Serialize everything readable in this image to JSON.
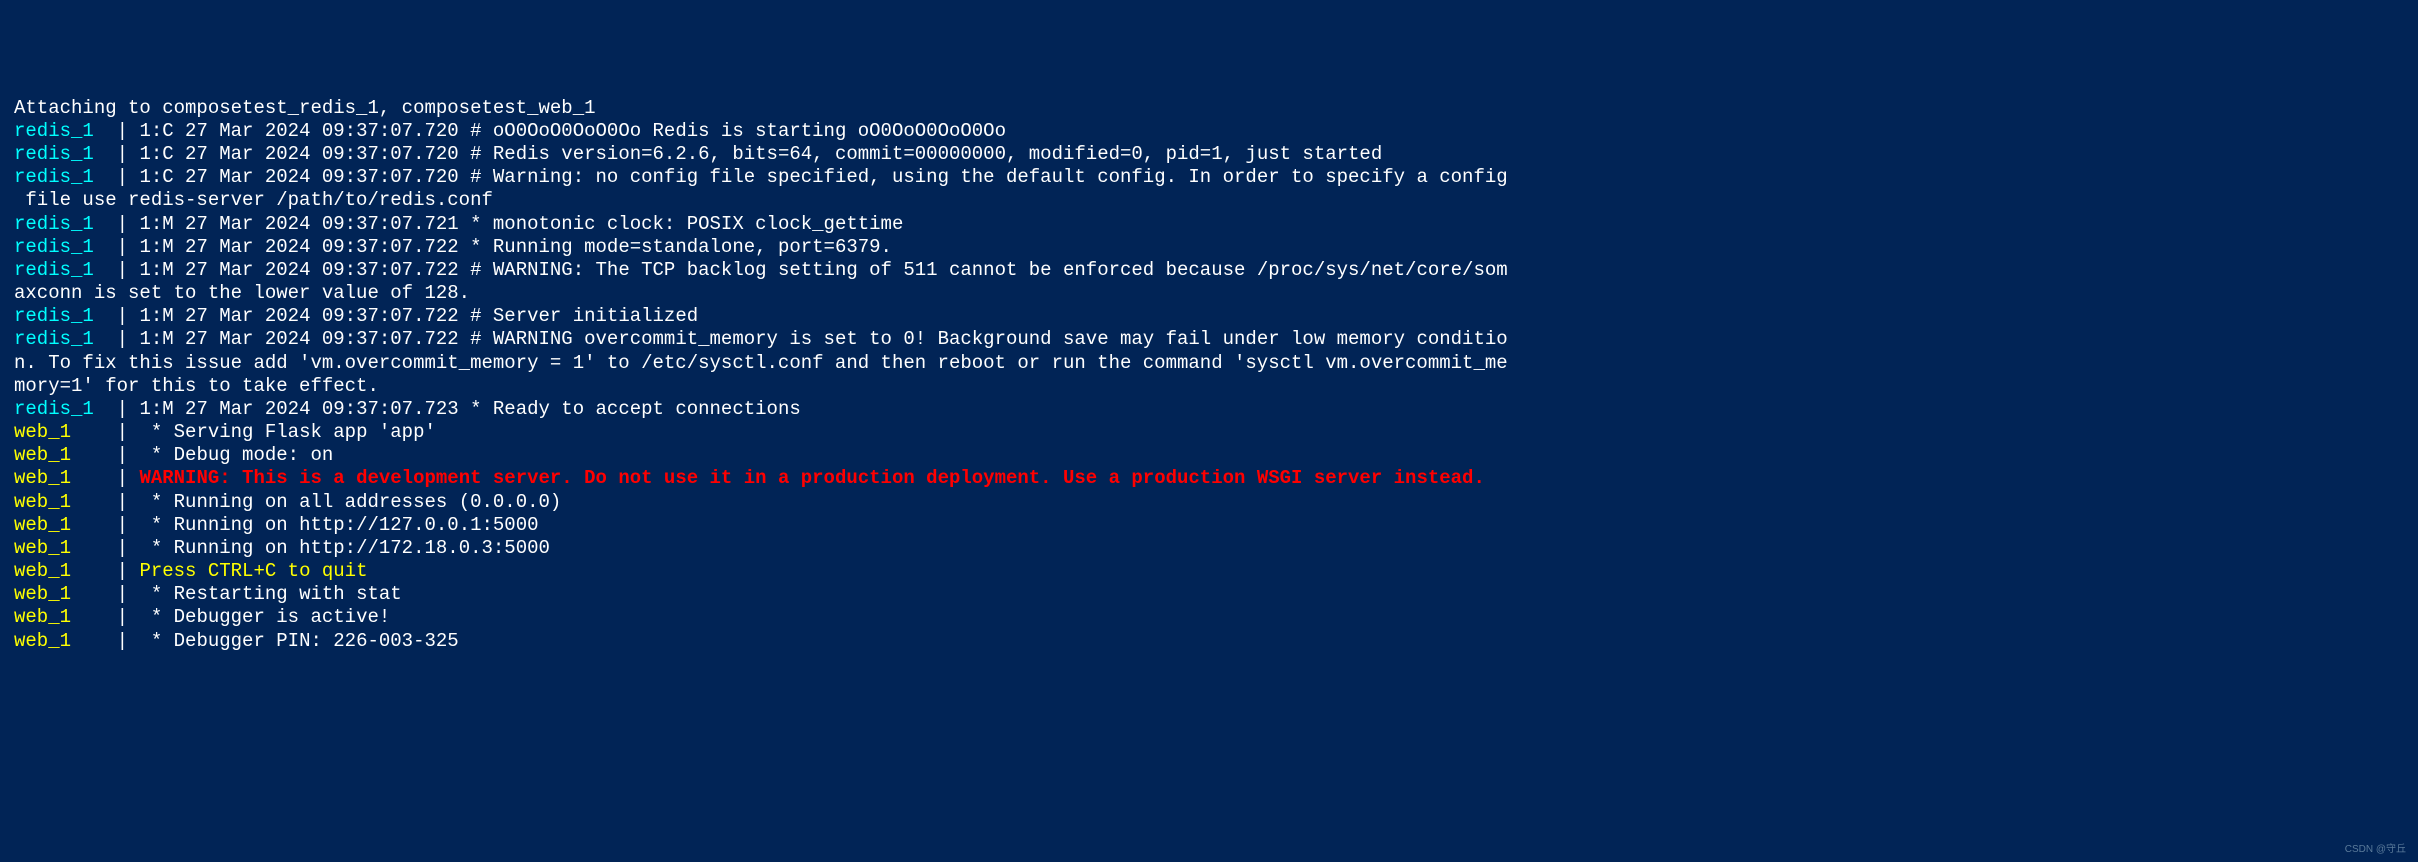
{
  "lines": [
    {
      "prefix_class": "white",
      "prefix": "Attaching to composetest_redis_1, composetest_web_1",
      "sep": "",
      "msg_class": "white",
      "msg": ""
    },
    {
      "prefix_class": "redis",
      "prefix": "redis_1  ",
      "sep": "| ",
      "msg_class": "white",
      "msg": "1:C 27 Mar 2024 09:37:07.720 # oO0OoO0OoO0Oo Redis is starting oO0OoO0OoO0Oo"
    },
    {
      "prefix_class": "redis",
      "prefix": "redis_1  ",
      "sep": "| ",
      "msg_class": "white",
      "msg": "1:C 27 Mar 2024 09:37:07.720 # Redis version=6.2.6, bits=64, commit=00000000, modified=0, pid=1, just started"
    },
    {
      "prefix_class": "redis",
      "prefix": "redis_1  ",
      "sep": "| ",
      "msg_class": "white",
      "msg": "1:C 27 Mar 2024 09:37:07.720 # Warning: no config file specified, using the default config. In order to specify a config"
    },
    {
      "prefix_class": "white",
      "prefix": " file use redis-server /path/to/redis.conf",
      "sep": "",
      "msg_class": "white",
      "msg": ""
    },
    {
      "prefix_class": "redis",
      "prefix": "redis_1  ",
      "sep": "| ",
      "msg_class": "white",
      "msg": "1:M 27 Mar 2024 09:37:07.721 * monotonic clock: POSIX clock_gettime"
    },
    {
      "prefix_class": "redis",
      "prefix": "redis_1  ",
      "sep": "| ",
      "msg_class": "white",
      "msg": "1:M 27 Mar 2024 09:37:07.722 * Running mode=standalone, port=6379."
    },
    {
      "prefix_class": "redis",
      "prefix": "redis_1  ",
      "sep": "| ",
      "msg_class": "white",
      "msg": "1:M 27 Mar 2024 09:37:07.722 # WARNING: The TCP backlog setting of 511 cannot be enforced because /proc/sys/net/core/som"
    },
    {
      "prefix_class": "white",
      "prefix": "axconn is set to the lower value of 128.",
      "sep": "",
      "msg_class": "white",
      "msg": ""
    },
    {
      "prefix_class": "redis",
      "prefix": "redis_1  ",
      "sep": "| ",
      "msg_class": "white",
      "msg": "1:M 27 Mar 2024 09:37:07.722 # Server initialized"
    },
    {
      "prefix_class": "redis",
      "prefix": "redis_1  ",
      "sep": "| ",
      "msg_class": "white",
      "msg": "1:M 27 Mar 2024 09:37:07.722 # WARNING overcommit_memory is set to 0! Background save may fail under low memory conditio"
    },
    {
      "prefix_class": "white",
      "prefix": "n. To fix this issue add 'vm.overcommit_memory = 1' to /etc/sysctl.conf and then reboot or run the command 'sysctl vm.overcommit_me",
      "sep": "",
      "msg_class": "white",
      "msg": ""
    },
    {
      "prefix_class": "white",
      "prefix": "mory=1' for this to take effect.",
      "sep": "",
      "msg_class": "white",
      "msg": ""
    },
    {
      "prefix_class": "redis",
      "prefix": "redis_1  ",
      "sep": "| ",
      "msg_class": "white",
      "msg": "1:M 27 Mar 2024 09:37:07.723 * Ready to accept connections"
    },
    {
      "prefix_class": "web",
      "prefix": "web_1    ",
      "sep": "| ",
      "msg_class": "white",
      "msg": " * Serving Flask app 'app'"
    },
    {
      "prefix_class": "web",
      "prefix": "web_1    ",
      "sep": "| ",
      "msg_class": "white",
      "msg": " * Debug mode: on"
    },
    {
      "prefix_class": "web",
      "prefix": "web_1    ",
      "sep": "| ",
      "msg_class": "red",
      "msg": "WARNING: This is a development server. Do not use it in a production deployment. Use a production WSGI server instead."
    },
    {
      "prefix_class": "web",
      "prefix": "web_1    ",
      "sep": "| ",
      "msg_class": "white",
      "msg": " * Running on all addresses (0.0.0.0)"
    },
    {
      "prefix_class": "web",
      "prefix": "web_1    ",
      "sep": "| ",
      "msg_class": "white",
      "msg": " * Running on http://127.0.0.1:5000"
    },
    {
      "prefix_class": "web",
      "prefix": "web_1    ",
      "sep": "| ",
      "msg_class": "white",
      "msg": " * Running on http://172.18.0.3:5000"
    },
    {
      "prefix_class": "web",
      "prefix": "web_1    ",
      "sep": "| ",
      "msg_class": "yellow",
      "msg": "Press CTRL+C to quit"
    },
    {
      "prefix_class": "web",
      "prefix": "web_1    ",
      "sep": "| ",
      "msg_class": "white",
      "msg": " * Restarting with stat"
    },
    {
      "prefix_class": "web",
      "prefix": "web_1    ",
      "sep": "| ",
      "msg_class": "white",
      "msg": " * Debugger is active!"
    },
    {
      "prefix_class": "web",
      "prefix": "web_1    ",
      "sep": "| ",
      "msg_class": "white",
      "msg": " * Debugger PIN: 226-003-325"
    }
  ],
  "watermark": "CSDN @守丘"
}
